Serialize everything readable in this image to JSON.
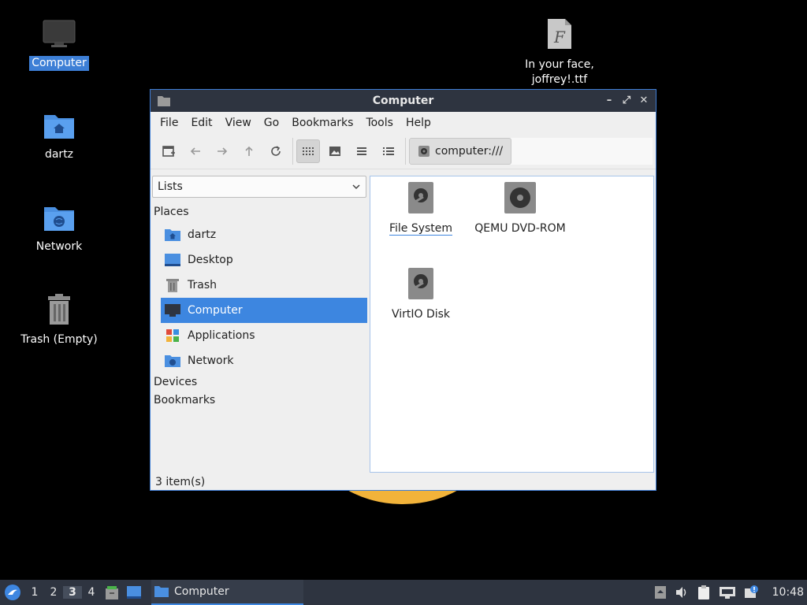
{
  "desktop": {
    "icons": [
      {
        "label": "Computer",
        "selected": true
      },
      {
        "label": "dartz"
      },
      {
        "label": "Network"
      },
      {
        "label": "Trash (Empty)"
      }
    ],
    "file_icon": {
      "label_line1": "In your face,",
      "label_line2": "joffrey!.ttf"
    }
  },
  "window": {
    "title": "Computer",
    "controls": {
      "minimize": "–",
      "maximize": "⤢",
      "close": "✕"
    },
    "menu": [
      "File",
      "Edit",
      "View",
      "Go",
      "Bookmarks",
      "Tools",
      "Help"
    ],
    "toolbar": {
      "buttons": [
        "new-tab-icon",
        "back-icon",
        "forward-icon",
        "up-icon",
        "reload-icon",
        "icon-view-icon",
        "thumbnail-view-icon",
        "compact-view-icon",
        "detailed-view-icon"
      ],
      "path": "computer:///"
    },
    "sidepane": {
      "mode": "Lists",
      "places_header": "Places",
      "places": [
        {
          "label": "dartz"
        },
        {
          "label": "Desktop"
        },
        {
          "label": "Trash"
        },
        {
          "label": "Computer",
          "selected": true
        },
        {
          "label": "Applications"
        },
        {
          "label": "Network"
        }
      ],
      "devices_header": "Devices",
      "bookmarks_header": "Bookmarks"
    },
    "items": [
      {
        "label": "File System"
      },
      {
        "label": "QEMU DVD-ROM"
      },
      {
        "label": "VirtIO Disk"
      }
    ],
    "status": "3 item(s)"
  },
  "taskbar": {
    "workspaces": [
      "1",
      "2",
      "3",
      "4"
    ],
    "active_workspace": "3",
    "task_label": "Computer",
    "clock": "10:48"
  },
  "colors": {
    "accent": "#3d86e0",
    "panel": "#2e3440",
    "folder": "#4a8fe0"
  }
}
